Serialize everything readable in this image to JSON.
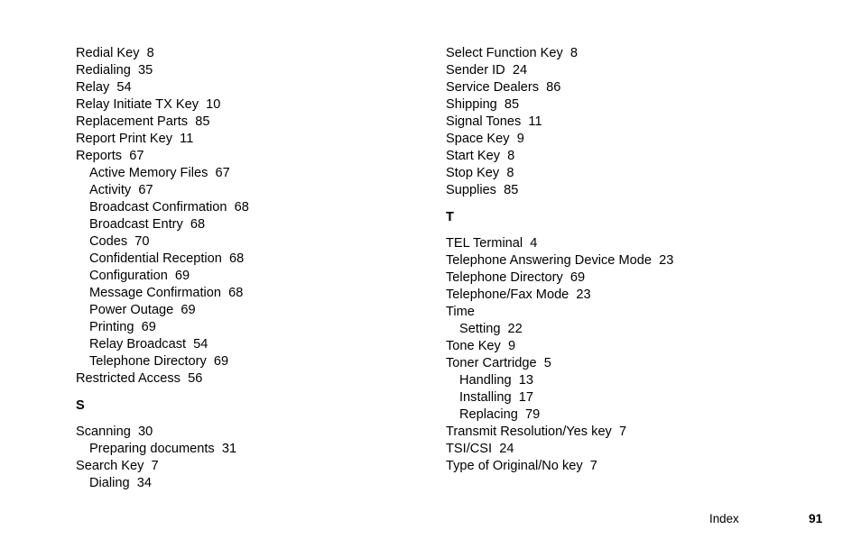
{
  "document": {
    "type": "index-page",
    "background_color": "#ffffff",
    "text_color": "#000000"
  },
  "columns": {
    "left": {
      "blocks": [
        {
          "kind": "entries",
          "entries": [
            {
              "level": 1,
              "term": "Redial Key",
              "page": "8"
            },
            {
              "level": 1,
              "term": "Redialing",
              "page": "35"
            },
            {
              "level": 1,
              "term": "Relay",
              "page": "54"
            },
            {
              "level": 1,
              "term": "Relay Initiate TX Key",
              "page": "10"
            },
            {
              "level": 1,
              "term": "Replacement Parts",
              "page": "85"
            },
            {
              "level": 1,
              "term": "Report Print Key",
              "page": "11"
            },
            {
              "level": 1,
              "term": "Reports",
              "page": "67"
            },
            {
              "level": 2,
              "term": "Active Memory Files",
              "page": "67"
            },
            {
              "level": 2,
              "term": "Activity",
              "page": "67"
            },
            {
              "level": 2,
              "term": "Broadcast Confirmation",
              "page": "68"
            },
            {
              "level": 2,
              "term": "Broadcast Entry",
              "page": "68"
            },
            {
              "level": 2,
              "term": "Codes",
              "page": "70"
            },
            {
              "level": 2,
              "term": "Confidential Reception",
              "page": "68"
            },
            {
              "level": 2,
              "term": "Configuration",
              "page": "69"
            },
            {
              "level": 2,
              "term": "Message Confirmation",
              "page": "68"
            },
            {
              "level": 2,
              "term": "Power Outage",
              "page": "69"
            },
            {
              "level": 2,
              "term": "Printing",
              "page": "69"
            },
            {
              "level": 2,
              "term": "Relay Broadcast",
              "page": "54"
            },
            {
              "level": 2,
              "term": "Telephone Directory",
              "page": "69"
            },
            {
              "level": 1,
              "term": "Restricted Access",
              "page": "56"
            }
          ]
        },
        {
          "kind": "heading",
          "letter": "S"
        },
        {
          "kind": "entries",
          "entries": [
            {
              "level": 1,
              "term": "Scanning",
              "page": "30"
            },
            {
              "level": 2,
              "term": "Preparing documents",
              "page": "31"
            },
            {
              "level": 1,
              "term": "Search Key",
              "page": "7"
            },
            {
              "level": 2,
              "term": "Dialing",
              "page": "34"
            }
          ]
        }
      ]
    },
    "right": {
      "blocks": [
        {
          "kind": "entries",
          "entries": [
            {
              "level": 1,
              "term": "Select Function Key",
              "page": "8"
            },
            {
              "level": 1,
              "term": "Sender ID",
              "page": "24"
            },
            {
              "level": 1,
              "term": "Service Dealers",
              "page": "86"
            },
            {
              "level": 1,
              "term": "Shipping",
              "page": "85"
            },
            {
              "level": 1,
              "term": "Signal Tones",
              "page": "11"
            },
            {
              "level": 1,
              "term": "Space Key",
              "page": "9"
            },
            {
              "level": 1,
              "term": "Start Key",
              "page": "8"
            },
            {
              "level": 1,
              "term": "Stop Key",
              "page": "8"
            },
            {
              "level": 1,
              "term": "Supplies",
              "page": "85"
            }
          ]
        },
        {
          "kind": "heading",
          "letter": "T"
        },
        {
          "kind": "entries",
          "entries": [
            {
              "level": 1,
              "term": "TEL Terminal",
              "page": "4"
            },
            {
              "level": 1,
              "term": "Telephone Answering Device Mode",
              "page": "23"
            },
            {
              "level": 1,
              "term": "Telephone Directory",
              "page": "69"
            },
            {
              "level": 1,
              "term": "Telephone/Fax Mode",
              "page": "23"
            },
            {
              "level": 1,
              "term": "Time",
              "page": ""
            },
            {
              "level": 2,
              "term": "Setting",
              "page": "22"
            },
            {
              "level": 1,
              "term": "Tone Key",
              "page": "9"
            },
            {
              "level": 1,
              "term": "Toner Cartridge",
              "page": "5"
            },
            {
              "level": 2,
              "term": "Handling",
              "page": "13"
            },
            {
              "level": 2,
              "term": "Installing",
              "page": "17"
            },
            {
              "level": 2,
              "term": "Replacing",
              "page": "79"
            },
            {
              "level": 1,
              "term": "Transmit Resolution/Yes key",
              "page": "7"
            },
            {
              "level": 1,
              "term": "TSI/CSI",
              "page": "24"
            },
            {
              "level": 1,
              "term": "Type of Original/No key",
              "page": "7"
            }
          ]
        }
      ]
    }
  },
  "footer": {
    "label": "Index",
    "page_number": "91"
  }
}
